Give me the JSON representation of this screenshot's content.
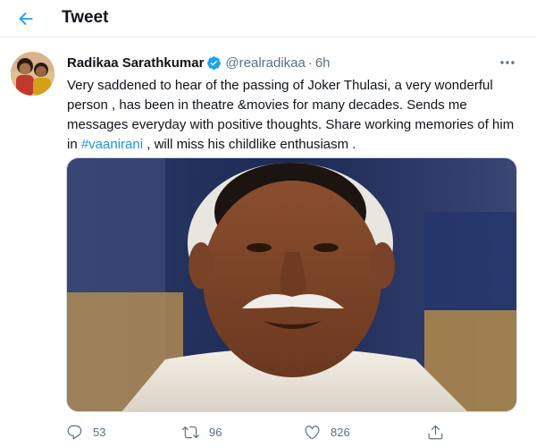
{
  "header": {
    "title": "Tweet",
    "back_icon": "back-arrow-icon"
  },
  "tweet": {
    "author": {
      "name": "Radikaa Sarathkumar",
      "handle": "@realradikaa",
      "verified": true,
      "separator": "·",
      "time": "6h"
    },
    "text_before": "Very saddened to hear of the passing of Joker Thulasi, a very wonderful person , has been in theatre &movies for many decades. Sends me messages everyday with positive thoughts. Share working memories of him in ",
    "hashtag": "#vaanirani",
    "text_after": " , will miss his childlike enthusiasm .",
    "actions": {
      "replies": "53",
      "retweets": "96",
      "likes": "826"
    }
  },
  "colors": {
    "accent": "#1da1f2",
    "hashtag": "#1b95e0",
    "secondary_text": "#5b7083",
    "divider": "#ebeef0"
  }
}
